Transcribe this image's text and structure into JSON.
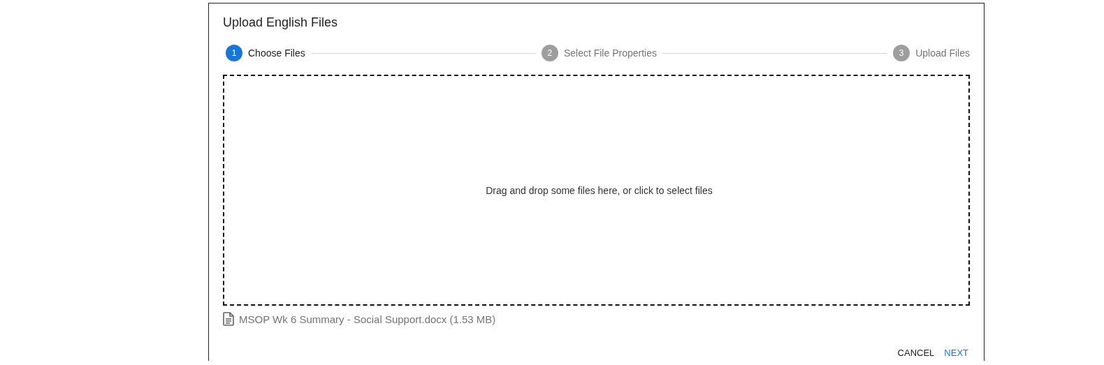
{
  "dialog": {
    "title": "Upload English Files"
  },
  "steps": [
    {
      "number": "1",
      "label": "Choose Files",
      "selected": true
    },
    {
      "number": "2",
      "label": "Select File Properties",
      "selected": false
    },
    {
      "number": "3",
      "label": "Upload Files",
      "selected": false
    }
  ],
  "dropzone": {
    "message": "Drag and drop some files here, or click to select files"
  },
  "files": [
    {
      "name": "MSOP Wk 6 Summary - Social Support.docx (1.53 MB)"
    }
  ],
  "buttons": [
    {
      "label": "CANCEL",
      "kind": "plain"
    },
    {
      "label": "NEXT",
      "kind": "primary"
    }
  ]
}
